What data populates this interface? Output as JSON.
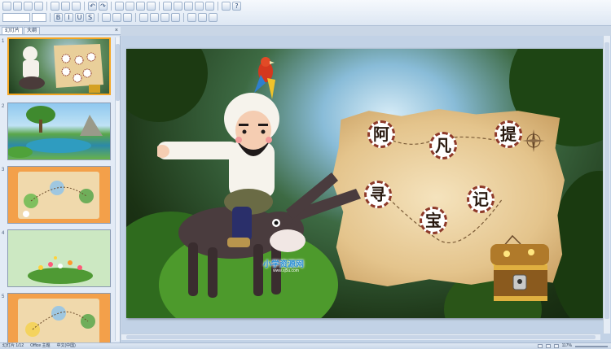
{
  "panel": {
    "tabs": [
      {
        "label": "幻灯片"
      },
      {
        "label": "大纲"
      }
    ],
    "close_glyph": "×"
  },
  "slides": [
    {
      "number": "1",
      "theme": "jungle-title"
    },
    {
      "number": "2",
      "theme": "lake"
    },
    {
      "number": "3",
      "theme": "treasure-map"
    },
    {
      "number": "4",
      "theme": "flower-meadow"
    },
    {
      "number": "5",
      "theme": "treasure-map"
    }
  ],
  "slide": {
    "title_chars": [
      "阿",
      "凡",
      "提",
      "寻",
      "宝",
      "记"
    ],
    "watermark": "小学资源网",
    "watermark_url": "www.xj5u.com"
  },
  "status": {
    "slide_info": "幻灯片 1/12",
    "theme": "Office 主题",
    "language": "中文(中国)",
    "zoom": "117%"
  },
  "colors": {
    "accent_selected": "#f5a623",
    "title_char_border": "#8e3a2a",
    "map_parchment": "#e4c48c",
    "map_thumb_orange": "#f3a04a"
  },
  "icons": [
    "save-icon",
    "undo-icon",
    "redo-icon",
    "bold-icon",
    "italic-icon",
    "underline-icon",
    "align-left-icon",
    "align-center-icon",
    "align-right-icon",
    "bullets-icon",
    "shapes-icon",
    "help-icon"
  ]
}
